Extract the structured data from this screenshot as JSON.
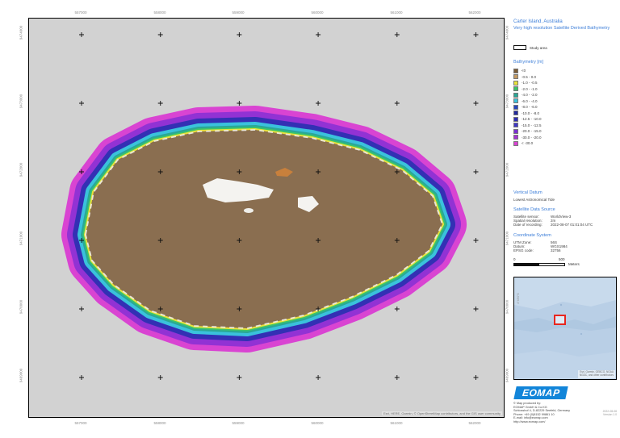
{
  "header": {
    "title": "Carter Island, Australia",
    "subtitle": "Very high resolution Satellite Derived Bathymetry"
  },
  "study_area": {
    "label": "Study area"
  },
  "legend": {
    "title": "Bathymetry [m]",
    "classes": [
      {
        "label": "<0",
        "color": "#7a5c36"
      },
      {
        "label": "-0.5 - 0.0",
        "color": "#c49a62"
      },
      {
        "label": "-1.0 - -0.5",
        "color": "#e8e23c"
      },
      {
        "label": "-2.0 - -1.0",
        "color": "#3cc46a"
      },
      {
        "label": "-4.0 - -2.0",
        "color": "#2aa896"
      },
      {
        "label": "-6.0 - -4.0",
        "color": "#3ac2dc"
      },
      {
        "label": "-8.0 - -6.0",
        "color": "#2546be"
      },
      {
        "label": "-10.0 - -8.0",
        "color": "#232a9e"
      },
      {
        "label": "-12.5 - -10.0",
        "color": "#2d2db4"
      },
      {
        "label": "-15.0 - -12.5",
        "color": "#4038c8"
      },
      {
        "label": "-20.0 - -15.0",
        "color": "#7a30d2"
      },
      {
        "label": "-30.0 - -20.0",
        "color": "#a432d4"
      },
      {
        "label": "< -30.0",
        "color": "#d944d2"
      }
    ]
  },
  "vertical_datum": {
    "heading": "Vertical Datum",
    "value": "Lowest Astronomical Tide"
  },
  "data_source": {
    "heading": "Satellite Data Source",
    "rows": [
      {
        "label": "Satellite sensor:",
        "value": "WorldView-3"
      },
      {
        "label": "Spatial resolution:",
        "value": "2m"
      },
      {
        "label": "Date of recording:",
        "value": "2022-08-07 01:01:04 UTC"
      }
    ]
  },
  "coordinate_system": {
    "heading": "Coordinate System",
    "rows": [
      {
        "label": "UTM Zone:",
        "value": "56S"
      },
      {
        "label": "Datum:",
        "value": "WGS1984"
      },
      {
        "label": "EPSG code:",
        "value": "32756"
      }
    ]
  },
  "scalebar": {
    "start": "0",
    "end": "500",
    "unit": "Meters"
  },
  "map": {
    "attribution": "Esri, HERE, Garmin, © OpenStreetMap contributors, and the GIS user community",
    "x_ticks": [
      "557000",
      "558000",
      "559000",
      "560000",
      "561000",
      "562000"
    ],
    "y_ticks": [
      "9474000",
      "9473000",
      "9472000",
      "9471000",
      "9470000",
      "9469000"
    ]
  },
  "overview": {
    "lat_label": "4°45'0\"S",
    "attribution_line1": "Esri, Garmin, GEBCO, NOAA",
    "attribution_line2": "NGDC, and other contributors"
  },
  "footer": {
    "logo_text": "EOMAP",
    "lines": [
      "© Map produced by:",
      "EOMAP GmbH & Co.KG",
      "Schlosshof 4, D-82229 Seefeld, Germany",
      "Phone: +49 (0)8152 99861 10",
      "E-mail: info@eomap.com"
    ],
    "url": "http://www.eomap.com/",
    "version_line1": "2022-08-08",
    "version_line2": "Version 1.0"
  }
}
